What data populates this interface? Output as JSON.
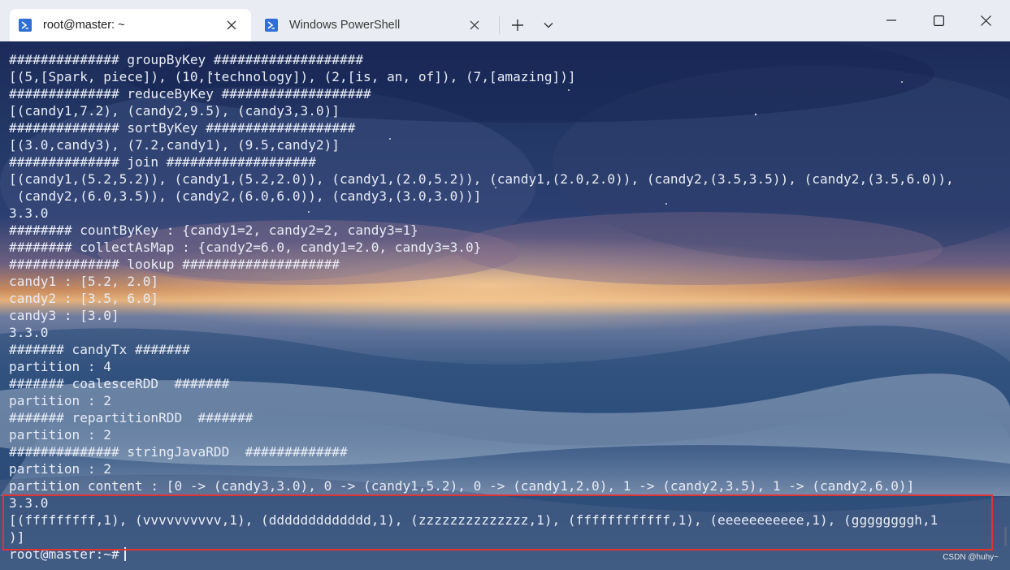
{
  "tabs": [
    {
      "label": "root@master: ~",
      "active": true
    },
    {
      "label": "Windows PowerShell",
      "active": false
    }
  ],
  "colors": {
    "titlebar": "#e9edf3",
    "tab_active": "#ffffff",
    "highlight_box": "#e03434",
    "terminal_text": "#e8ecf5",
    "tab_icon": "#2f6fd6"
  },
  "icons": [
    "powershell-icon",
    "close-icon",
    "plus-icon",
    "chevron-down-icon",
    "minimize-icon",
    "maximize-icon",
    "window-close-icon"
  ],
  "terminal": {
    "lines": [
      "############## groupByKey ###################",
      "[(5,[Spark, piece]), (10,[technology]), (2,[is, an, of]), (7,[amazing])]",
      "############## reduceByKey ###################",
      "[(candy1,7.2), (candy2,9.5), (candy3,3.0)]",
      "############## sortByKey ###################",
      "[(3.0,candy3), (7.2,candy1), (9.5,candy2)]",
      "############## join ###################",
      "[(candy1,(5.2,5.2)), (candy1,(5.2,2.0)), (candy1,(2.0,5.2)), (candy1,(2.0,2.0)), (candy2,(3.5,3.5)), (candy2,(3.5,6.0)),",
      " (candy2,(6.0,3.5)), (candy2,(6.0,6.0)), (candy3,(3.0,3.0))]",
      "3.3.0",
      "######## countByKey : {candy1=2, candy2=2, candy3=1}",
      "######## collectAsMap : {candy2=6.0, candy1=2.0, candy3=3.0}",
      "############## lookup ####################",
      "candy1 : [5.2, 2.0]",
      "candy2 : [3.5, 6.0]",
      "candy3 : [3.0]",
      "3.3.0",
      "####### candyTx #######",
      "partition : 4",
      "####### coalesceRDD  #######",
      "partition : 2",
      "####### repartitionRDD  #######",
      "partition : 2",
      "############## stringJavaRDD  #############",
      "partition : 2",
      "partition content : [0 -> (candy3,3.0), 0 -> (candy1,5.2), 0 -> (candy1,2.0), 1 -> (candy2,3.5), 1 -> (candy2,6.0)]",
      "3.3.0",
      "[(fffffffff,1), (vvvvvvvvvv,1), (ddddddddddddd,1), (zzzzzzzzzzzzzz,1), (ffffffffffff,1), (eeeeeeeeeee,1), (ggggggggh,1",
      ")]"
    ],
    "prompt": "root@master:~#"
  },
  "watermark": "CSDN @huhy~"
}
